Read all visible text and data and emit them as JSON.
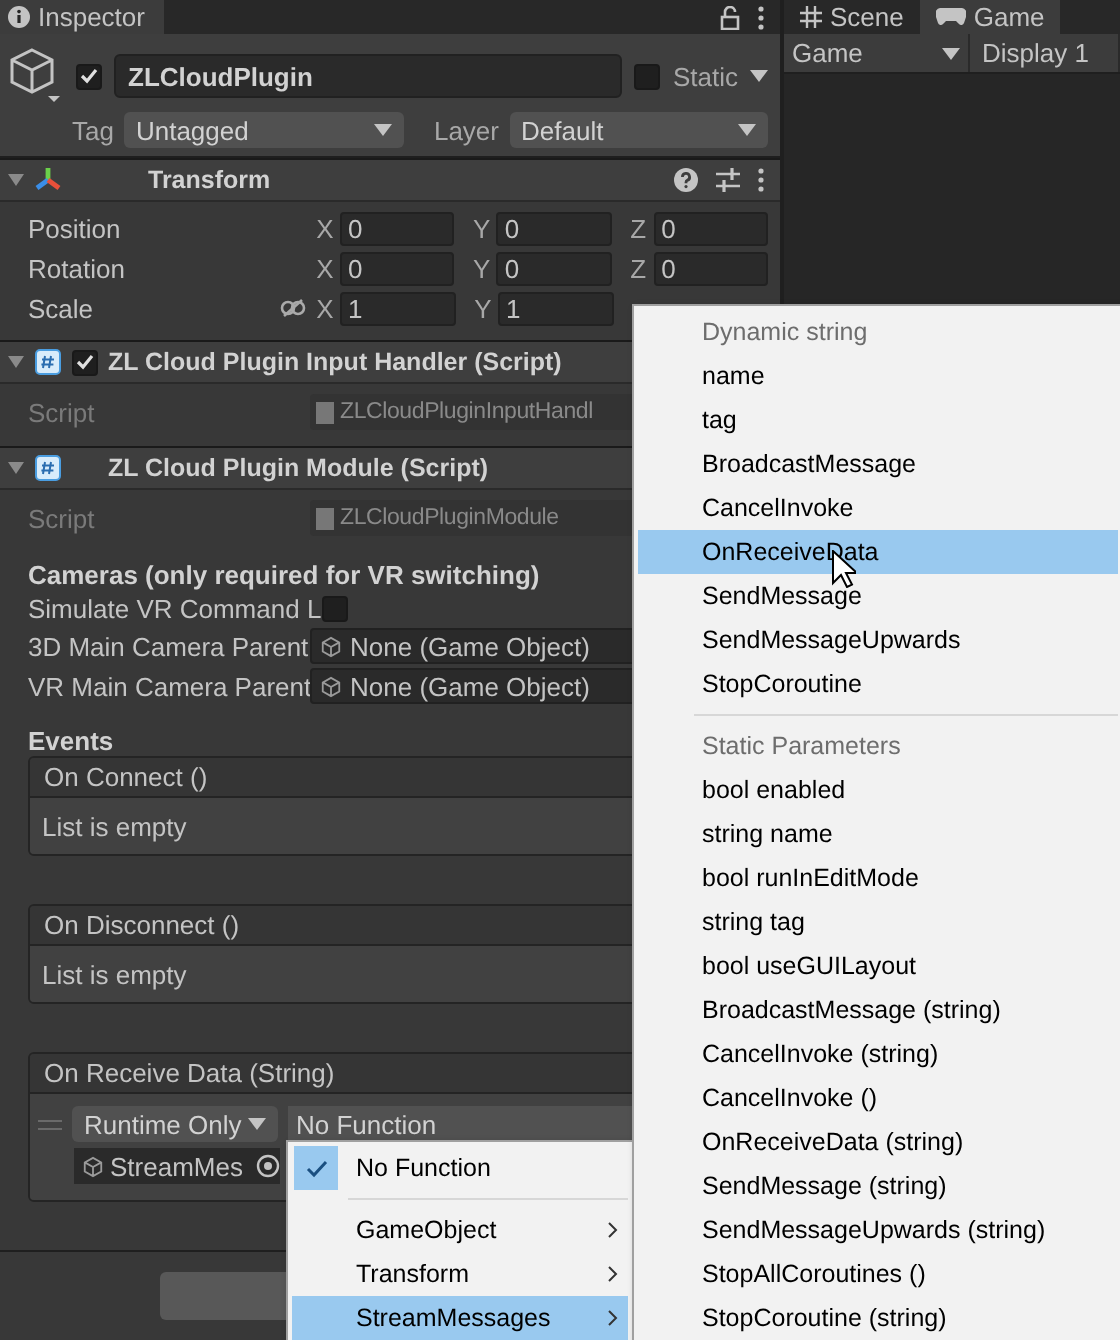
{
  "inspector": {
    "tab": {
      "label": "Inspector",
      "selected": true
    },
    "object": {
      "active": true,
      "name": "ZLCloudPlugin",
      "static": false,
      "static_label": "Static",
      "tag_label": "Tag",
      "tag": "Untagged",
      "layer_label": "Layer",
      "layer": "Default"
    },
    "components": [
      {
        "kind": "transform",
        "title": "Transform",
        "expanded": true,
        "rows": [
          {
            "kind": "vector",
            "label": "Position",
            "axes": [
              {
                "axis": "X",
                "value": "0"
              },
              {
                "axis": "Y",
                "value": "0"
              },
              {
                "axis": "Z",
                "value": "0"
              }
            ]
          },
          {
            "kind": "vector",
            "label": "Rotation",
            "axes": [
              {
                "axis": "X",
                "value": "0"
              },
              {
                "axis": "Y",
                "value": "0"
              },
              {
                "axis": "Z",
                "value": "0"
              }
            ]
          },
          {
            "kind": "scale",
            "label": "Scale",
            "axes": [
              {
                "axis": "X",
                "value": "1"
              },
              {
                "axis": "Y",
                "value": "1"
              }
            ]
          }
        ]
      },
      {
        "kind": "script",
        "title": "ZL Cloud Plugin Input Handler (Script)",
        "expanded": true,
        "enabled": true,
        "script_label": "Script",
        "script": "ZLCloudPluginInputHandl"
      },
      {
        "kind": "script",
        "title": "ZL Cloud Plugin Module (Script)",
        "expanded": true,
        "script_label": "Script",
        "script": "ZLCloudPluginModule",
        "heading": "Cameras (only required for VR switching)",
        "fields": [
          {
            "kind": "toggle",
            "label": "Simulate VR Command L",
            "checked": false
          },
          {
            "kind": "object",
            "label": "3D Main Camera Parent",
            "value": "None (Game Object)"
          },
          {
            "kind": "object",
            "label": "VR Main Camera Parent",
            "value": "None (Game Object)"
          }
        ],
        "events_label": "Events",
        "events": [
          {
            "title": "On Connect ()",
            "empty_text": "List is empty"
          },
          {
            "title": "On Disconnect ()",
            "empty_text": "List is empty"
          },
          {
            "title": "On Receive Data (String)",
            "listeners": [
              {
                "mode": "Runtime Only",
                "function": "No Function",
                "target": "StreamMes"
              }
            ]
          }
        ]
      }
    ]
  },
  "game_view": {
    "tabs": [
      {
        "kind": "scene",
        "label": "Scene",
        "selected": false
      },
      {
        "kind": "game",
        "label": "Game",
        "selected": true
      }
    ],
    "view": "Game",
    "display": "Display 1"
  },
  "function_menu": {
    "items": [
      {
        "kind": "item",
        "label": "No Function",
        "checked": true,
        "selected": false
      },
      {
        "kind": "separator"
      },
      {
        "kind": "submenu",
        "label": "GameObject",
        "selected": false
      },
      {
        "kind": "submenu",
        "label": "Transform",
        "selected": false
      },
      {
        "kind": "submenu",
        "label": "StreamMessages",
        "selected": true
      }
    ]
  },
  "method_menu": {
    "items": [
      {
        "kind": "header",
        "label": "Dynamic string"
      },
      {
        "kind": "item",
        "label": "name",
        "selected": false
      },
      {
        "kind": "item",
        "label": "tag",
        "selected": false
      },
      {
        "kind": "item",
        "label": "BroadcastMessage",
        "selected": false
      },
      {
        "kind": "item",
        "label": "CancelInvoke",
        "selected": false
      },
      {
        "kind": "item",
        "label": "OnReceiveData",
        "selected": true
      },
      {
        "kind": "item",
        "label": "SendMessage",
        "selected": false
      },
      {
        "kind": "item",
        "label": "SendMessageUpwards",
        "selected": false
      },
      {
        "kind": "item",
        "label": "StopCoroutine",
        "selected": false
      },
      {
        "kind": "separator"
      },
      {
        "kind": "header",
        "label": "Static Parameters"
      },
      {
        "kind": "item",
        "label": "bool enabled",
        "selected": false
      },
      {
        "kind": "item",
        "label": "string name",
        "selected": false
      },
      {
        "kind": "item",
        "label": "bool runInEditMode",
        "selected": false
      },
      {
        "kind": "item",
        "label": "string tag",
        "selected": false
      },
      {
        "kind": "item",
        "label": "bool useGUILayout",
        "selected": false
      },
      {
        "kind": "item",
        "label": "BroadcastMessage (string)",
        "selected": false
      },
      {
        "kind": "item",
        "label": "CancelInvoke (string)",
        "selected": false
      },
      {
        "kind": "item",
        "label": "CancelInvoke ()",
        "selected": false
      },
      {
        "kind": "item",
        "label": "OnReceiveData (string)",
        "selected": false
      },
      {
        "kind": "item",
        "label": "SendMessage (string)",
        "selected": false
      },
      {
        "kind": "item",
        "label": "SendMessageUpwards (string)",
        "selected": false
      },
      {
        "kind": "item",
        "label": "StopAllCoroutines ()",
        "selected": false
      },
      {
        "kind": "item",
        "label": "StopCoroutine (string)",
        "selected": false
      }
    ]
  }
}
